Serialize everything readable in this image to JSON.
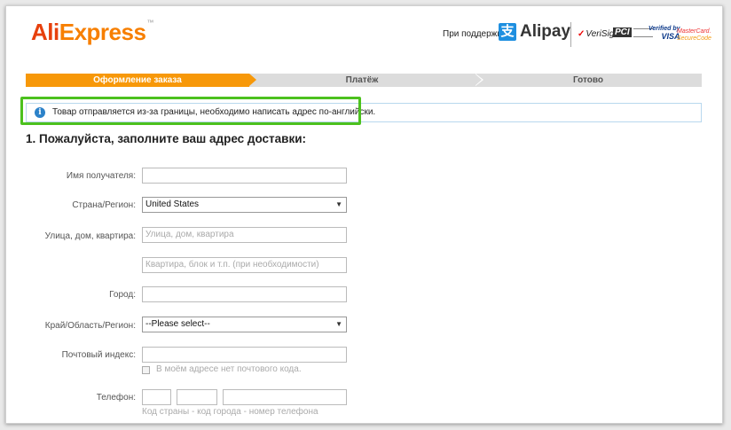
{
  "header": {
    "logo_ali": "Ali",
    "logo_express": "Express",
    "logo_tm": "™",
    "support_text": "При поддержке",
    "alipay_mark": "支",
    "alipay_text": "Alipay",
    "verisign": "VeriSign",
    "pci": "PCI",
    "vbv_line1": "Verified by",
    "vbv_line2": "VISA",
    "mc_line1": "MasterCard.",
    "mc_line2": "SecureCode"
  },
  "steps": [
    {
      "label": "Оформление заказа",
      "active": true
    },
    {
      "label": "Платёж",
      "active": false
    },
    {
      "label": "Готово",
      "active": false
    }
  ],
  "notice": {
    "icon": "i",
    "text": "Товар отправляется из-за границы, необходимо написать адрес по-английски."
  },
  "form": {
    "heading": "1. Пожалуйста, заполните ваш адрес доставки:",
    "recipient_label": "Имя получателя:",
    "recipient_value": "",
    "country_label": "Страна/Регион:",
    "country_value": "United States",
    "street_label": "Улица, дом, квартира:",
    "street_placeholder": "Улица, дом, квартира",
    "apt_placeholder": "Квартира, блок и т.п. (при необходимости)",
    "city_label": "Город:",
    "city_value": "",
    "region_label": "Край/Область/Регион:",
    "region_value": "--Please select--",
    "zip_label": "Почтовый индекс:",
    "no_zip_label": "В моём адресе нет почтового кода.",
    "phone_label": "Телефон:",
    "phone_hint": "Код страны - код города - номер телефона"
  },
  "colors": {
    "accent": "#f79809",
    "highlight": "#4cc11e",
    "info": "#2c82c9"
  }
}
